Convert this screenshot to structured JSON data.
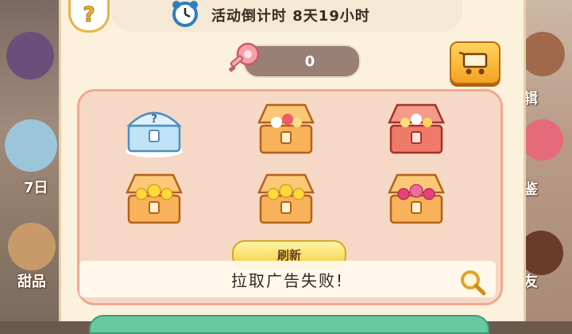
{
  "header": {
    "help_icon": "question-mark-icon",
    "timer_icon": "alarm-clock-icon",
    "timer_text": "活动倒计时  8天19小时"
  },
  "currency": {
    "icon": "key-icon",
    "count": "0"
  },
  "shop": {
    "icon": "shopping-cart-icon"
  },
  "chests": [
    {
      "kind": "mystery",
      "color": "#a8d4f0"
    },
    {
      "kind": "candy",
      "color": "#f5a24a"
    },
    {
      "kind": "candy",
      "color": "#ef6a5c"
    },
    {
      "kind": "gold",
      "color": "#f5a24a"
    },
    {
      "kind": "gold",
      "color": "#f5a24a"
    },
    {
      "kind": "gem",
      "color": "#f5a24a"
    }
  ],
  "refresh_label": "刷新",
  "toast_text": "拉取广告失败!",
  "side_left": [
    "7日",
    "甜品"
  ],
  "side_right": [
    "辑",
    "鉴",
    "友"
  ],
  "colors": {
    "panel": "#fbf1dc",
    "chest_area": "#f6d8c6",
    "accent_gold": "#f3cd3e"
  }
}
